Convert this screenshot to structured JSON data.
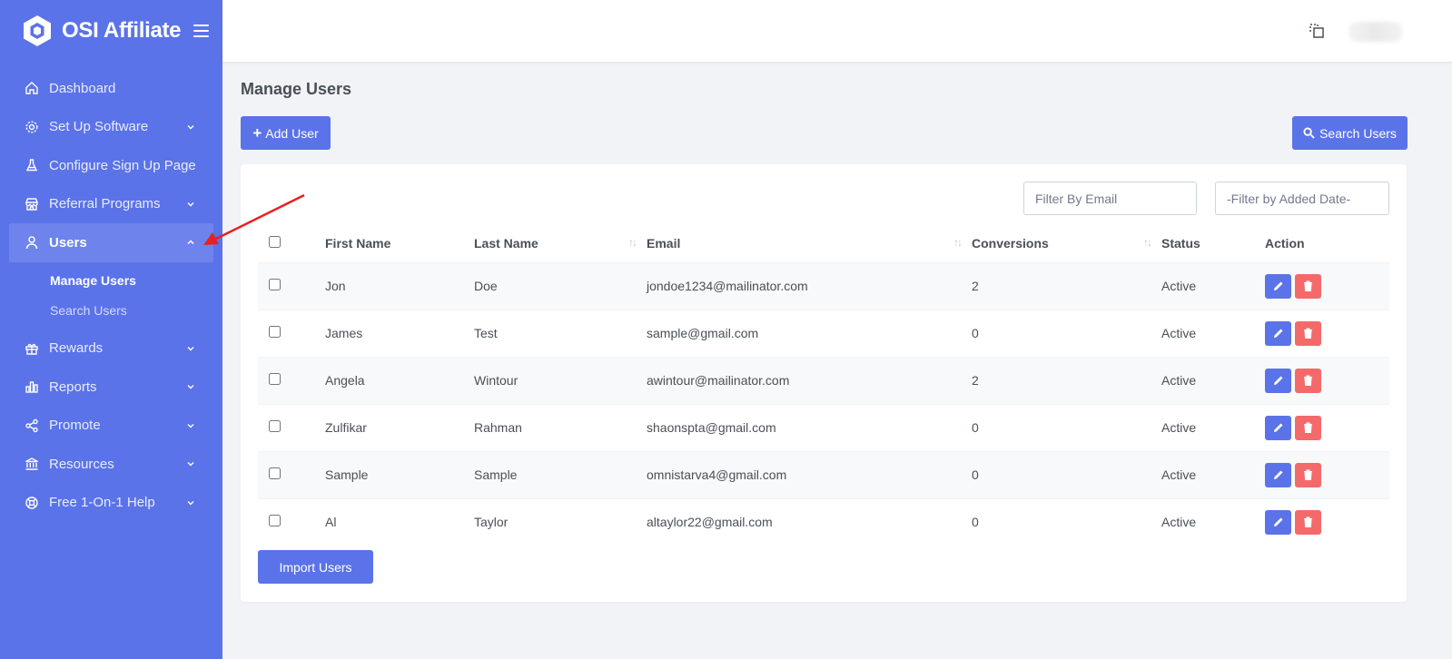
{
  "brand": {
    "name": "OSI Affiliate"
  },
  "sidebar": {
    "items": [
      {
        "label": "Dashboard",
        "icon": "home-icon",
        "chevron": false
      },
      {
        "label": "Set Up Software",
        "icon": "gear-icon",
        "chevron": true
      },
      {
        "label": "Configure Sign Up Page",
        "icon": "flask-icon",
        "chevron": false
      },
      {
        "label": "Referral Programs",
        "icon": "store-icon",
        "chevron": true
      },
      {
        "label": "Users",
        "icon": "user-icon",
        "chevron": true,
        "expanded": true
      },
      {
        "label": "Rewards",
        "icon": "gift-icon",
        "chevron": true
      },
      {
        "label": "Reports",
        "icon": "bar-chart-icon",
        "chevron": true
      },
      {
        "label": "Promote",
        "icon": "share-icon",
        "chevron": true
      },
      {
        "label": "Resources",
        "icon": "bank-icon",
        "chevron": true
      },
      {
        "label": "Free 1-On-1 Help",
        "icon": "lifebuoy-icon",
        "chevron": true
      }
    ],
    "users_sub": [
      {
        "label": "Manage Users",
        "current": true
      },
      {
        "label": "Search Users",
        "current": false
      }
    ]
  },
  "page": {
    "title": "Manage Users",
    "add_button": "Add User",
    "search_button": "Search Users",
    "import_button": "Import Users"
  },
  "filters": {
    "email_placeholder": "Filter By Email",
    "date_placeholder": "-Filter by Added Date-"
  },
  "table": {
    "headers": [
      "First Name",
      "Last Name",
      "Email",
      "Conversions",
      "Status",
      "Action"
    ],
    "rows": [
      {
        "first": "Jon",
        "last": "Doe",
        "email": "jondoe1234@mailinator.com",
        "conversions": "2",
        "status": "Active"
      },
      {
        "first": "James",
        "last": "Test",
        "email": "sample@gmail.com",
        "conversions": "0",
        "status": "Active"
      },
      {
        "first": "Angela",
        "last": "Wintour",
        "email": "awintour@mailinator.com",
        "conversions": "2",
        "status": "Active"
      },
      {
        "first": "Zulfikar",
        "last": "Rahman",
        "email": "shaonspta@gmail.com",
        "conversions": "0",
        "status": "Active"
      },
      {
        "first": "Sample",
        "last": "Sample",
        "email": "omnistarva4@gmail.com",
        "conversions": "0",
        "status": "Active"
      },
      {
        "first": "Al",
        "last": "Taylor",
        "email": "altaylor22@gmail.com",
        "conversions": "0",
        "status": "Active"
      }
    ]
  },
  "colors": {
    "sidebar": "#5b73e8",
    "primary": "#5b73e8",
    "danger": "#f46a6a",
    "annotation_arrow": "#e8201f"
  }
}
